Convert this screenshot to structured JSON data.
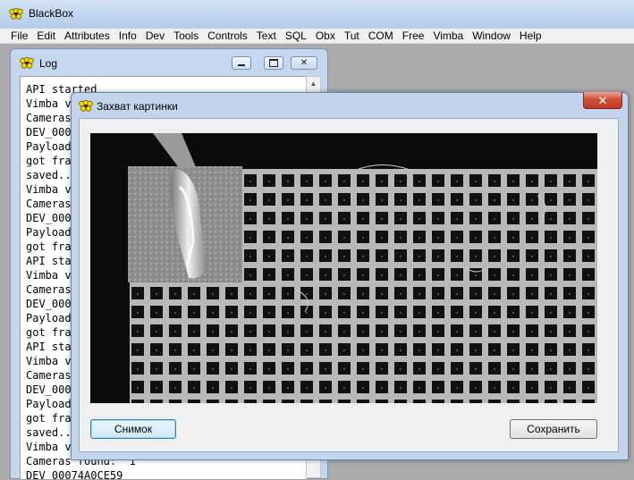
{
  "app": {
    "title": "BlackBox"
  },
  "menubar": [
    "File",
    "Edit",
    "Attributes",
    "Info",
    "Dev",
    "Tools",
    "Controls",
    "Text",
    "SQL",
    "Obx",
    "Tut",
    "COM",
    "Free",
    "Vimba",
    "Window",
    "Help"
  ],
  "log_window": {
    "title": "Log",
    "lines": [
      "API started",
      "Vimba v",
      "Cameras",
      "DEV_000",
      "Payload",
      "got fra",
      "saved..",
      "Vimba v",
      "Cameras",
      "DEV_000",
      "Payload",
      "got fra",
      "API sta",
      "Vimba v",
      "Cameras",
      "DEV_000",
      "Payload",
      "got fra",
      "API sta",
      "Vimba v",
      "Cameras",
      "DEV_000",
      "Payload",
      "got fra",
      "saved..",
      "Vimba v",
      "Cameras found:  1",
      "DEV_00074A0CE59"
    ]
  },
  "capture_dialog": {
    "title": "Захват картинки",
    "snapshot_button": "Снимок",
    "save_button": "Сохранить"
  },
  "icons": {
    "app": "bee-icon",
    "log": "bee-icon",
    "dialog": "bee-icon",
    "minimize": "minimize-icon",
    "restore": "restore-icon",
    "close": "close-icon"
  }
}
